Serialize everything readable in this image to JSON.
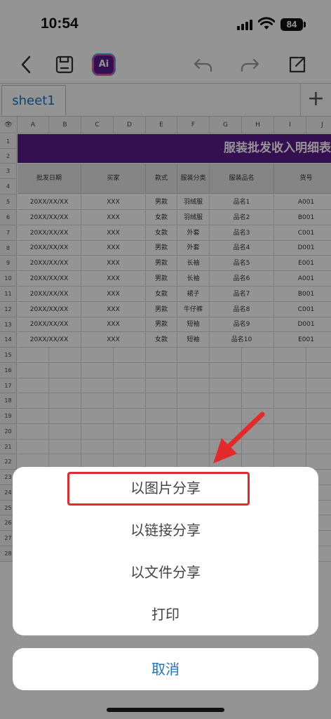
{
  "status_bar": {
    "time": "10:54",
    "battery": "84"
  },
  "toolbar": {
    "back_icon": "chevron-left-icon",
    "save_icon": "save-icon",
    "ai_label": "Ai",
    "undo_icon": "undo-icon",
    "redo_icon": "redo-icon",
    "share_icon": "share-icon"
  },
  "sheets": {
    "active_tab": "sheet1",
    "add_label": "+"
  },
  "grid": {
    "column_letters": [
      "A",
      "B",
      "C",
      "D",
      "E",
      "F",
      "G",
      "H",
      "I",
      "J"
    ],
    "row_numbers": [
      "1",
      "2",
      "3",
      "4",
      "5",
      "6",
      "7",
      "8",
      "9",
      "10",
      "11",
      "12",
      "13",
      "14",
      "15",
      "16",
      "17",
      "18",
      "19",
      "20",
      "21",
      "22",
      "23",
      "24",
      "25",
      "26",
      "27",
      "28"
    ],
    "banner_title": "服装批发收入明细表",
    "headers": [
      "批发日期",
      "买家",
      "款式",
      "服装分类",
      "服装品名",
      "货号"
    ],
    "rows": [
      [
        "20XX/XX/XX",
        "XXX",
        "男款",
        "羽绒服",
        "品名1",
        "A001"
      ],
      [
        "20XX/XX/XX",
        "XXX",
        "女款",
        "羽绒服",
        "品名2",
        "B001"
      ],
      [
        "20XX/XX/XX",
        "XXX",
        "女款",
        "外套",
        "品名3",
        "C001"
      ],
      [
        "20XX/XX/XX",
        "XXX",
        "男款",
        "外套",
        "品名4",
        "D001"
      ],
      [
        "20XX/XX/XX",
        "XXX",
        "男款",
        "长袖",
        "品名5",
        "E001"
      ],
      [
        "20XX/XX/XX",
        "XXX",
        "男款",
        "长袖",
        "品名6",
        "A001"
      ],
      [
        "20XX/XX/XX",
        "XXX",
        "女款",
        "裙子",
        "品名7",
        "B001"
      ],
      [
        "20XX/XX/XX",
        "XXX",
        "男款",
        "牛仔裤",
        "品名8",
        "C001"
      ],
      [
        "20XX/XX/XX",
        "XXX",
        "男款",
        "短袖",
        "品名9",
        "D001"
      ],
      [
        "20XX/XX/XX",
        "XXX",
        "女款",
        "短袖",
        "品名10",
        "E001"
      ]
    ]
  },
  "action_sheet": {
    "items": [
      "以图片分享",
      "以链接分享",
      "以文件分享",
      "打印"
    ],
    "cancel": "取消"
  },
  "colors": {
    "accent": "#1a73c8",
    "banner": "#5b1a8e",
    "highlight": "#e32a2a"
  }
}
